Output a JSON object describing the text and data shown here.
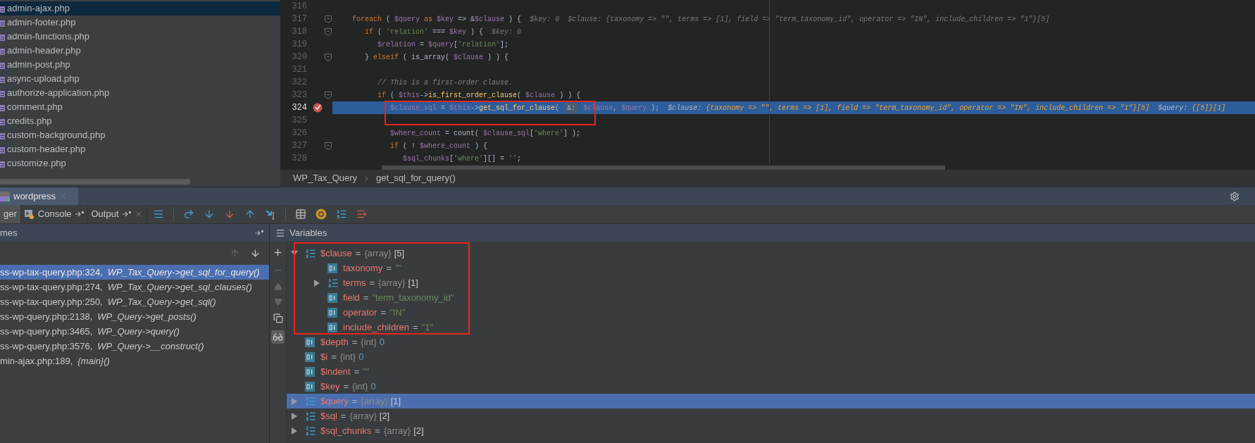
{
  "file_tree": {
    "items": [
      {
        "name": "admin-ajax.php",
        "selected": true
      },
      {
        "name": "admin-footer.php",
        "selected": false
      },
      {
        "name": "admin-functions.php",
        "selected": false
      },
      {
        "name": "admin-header.php",
        "selected": false
      },
      {
        "name": "admin-post.php",
        "selected": false
      },
      {
        "name": "async-upload.php",
        "selected": false
      },
      {
        "name": "authorize-application.php",
        "selected": false
      },
      {
        "name": "comment.php",
        "selected": false
      },
      {
        "name": "credits.php",
        "selected": false
      },
      {
        "name": "custom-background.php",
        "selected": false
      },
      {
        "name": "custom-header.php",
        "selected": false
      },
      {
        "name": "customize.php",
        "selected": false
      }
    ]
  },
  "editor": {
    "lines": [
      {
        "number": "316",
        "current": false,
        "breakpoint": false,
        "fold": false
      },
      {
        "number": "317",
        "current": false,
        "breakpoint": false,
        "fold": true,
        "tokens": [
          {
            "kind": "kw",
            "text": "    foreach"
          },
          {
            "kind": "op",
            "text": " ( "
          },
          {
            "kind": "var",
            "text": "$query"
          },
          {
            "kind": "kw",
            "text": " as "
          },
          {
            "kind": "var",
            "text": "$key"
          },
          {
            "kind": "op",
            "text": " => &"
          },
          {
            "kind": "var",
            "text": "$clause"
          },
          {
            "kind": "op",
            "text": " ) {"
          },
          {
            "kind": "hl",
            "text": "  $key: 0  $clause: "
          },
          {
            "kind": "hv",
            "text": "{taxonomy => \"\", terms => [1], field => \"term_taxonomy_id\", operator => \"IN\", include_children => \"1\"}[5]"
          }
        ]
      },
      {
        "number": "318",
        "current": false,
        "breakpoint": false,
        "fold": true,
        "tokens": [
          {
            "kind": "kw",
            "text": "       if"
          },
          {
            "kind": "op",
            "text": " ( "
          },
          {
            "kind": "str",
            "text": "'relation'"
          },
          {
            "kind": "op",
            "text": " === "
          },
          {
            "kind": "var",
            "text": "$key"
          },
          {
            "kind": "op",
            "text": " ) {"
          },
          {
            "kind": "hl",
            "text": "  $key: 0"
          }
        ]
      },
      {
        "number": "319",
        "current": false,
        "breakpoint": false,
        "fold": false,
        "tokens": [
          {
            "kind": "var",
            "text": "          $relation"
          },
          {
            "kind": "op",
            "text": " = "
          },
          {
            "kind": "var",
            "text": "$query"
          },
          {
            "kind": "op",
            "text": "["
          },
          {
            "kind": "str",
            "text": "'relation'"
          },
          {
            "kind": "op",
            "text": "];"
          }
        ]
      },
      {
        "number": "320",
        "current": false,
        "breakpoint": false,
        "fold": true,
        "tokens": [
          {
            "kind": "op",
            "text": "       } "
          },
          {
            "kind": "kw",
            "text": "elseif"
          },
          {
            "kind": "op",
            "text": " ( is_array( "
          },
          {
            "kind": "var",
            "text": "$clause"
          },
          {
            "kind": "op",
            "text": " ) ) {"
          }
        ]
      },
      {
        "number": "321",
        "current": false,
        "breakpoint": false,
        "fold": false
      },
      {
        "number": "322",
        "current": false,
        "breakpoint": false,
        "fold": false,
        "tokens": [
          {
            "kind": "cm",
            "text": "          // This is a first-order clause."
          }
        ]
      },
      {
        "number": "323",
        "current": false,
        "breakpoint": false,
        "fold": true,
        "tokens": [
          {
            "kind": "kw",
            "text": "          if"
          },
          {
            "kind": "op",
            "text": " ( "
          },
          {
            "kind": "var",
            "text": "$this"
          },
          {
            "kind": "op",
            "text": "->"
          },
          {
            "kind": "fn",
            "text": "is_first_order_clause"
          },
          {
            "kind": "op",
            "text": "( "
          },
          {
            "kind": "var",
            "text": "$clause"
          },
          {
            "kind": "op",
            "text": " ) ) {"
          }
        ]
      },
      {
        "number": "324",
        "current": true,
        "breakpoint": true,
        "fold": false,
        "tokens": [
          {
            "kind": "var",
            "text": "             $clause_sql"
          },
          {
            "kind": "op",
            "text": " = "
          },
          {
            "kind": "var",
            "text": "$this"
          },
          {
            "kind": "op",
            "text": "->"
          },
          {
            "kind": "fn",
            "text": "get_sql_for_clause"
          },
          {
            "kind": "op",
            "text": "( "
          },
          {
            "kind": "badge",
            "text": "&:"
          },
          {
            "kind": "var",
            "text": " $clause"
          },
          {
            "kind": "op",
            "text": ", "
          },
          {
            "kind": "var",
            "text": "$query"
          },
          {
            "kind": "op",
            "text": " );"
          },
          {
            "kind": "hl",
            "text": "  $clause: "
          },
          {
            "kind": "hv",
            "text": "{taxonomy => \"\", terms => [1], field => \"term_taxonomy_id\", operator => \"IN\", include_children => \"1\"}[5]"
          },
          {
            "kind": "hl",
            "text": "  $query: "
          },
          {
            "kind": "hv",
            "text": "{[5]}[1]"
          }
        ]
      },
      {
        "number": "325",
        "current": false,
        "breakpoint": false,
        "fold": false
      },
      {
        "number": "326",
        "current": false,
        "breakpoint": false,
        "fold": false,
        "tokens": [
          {
            "kind": "var",
            "text": "             $where_count"
          },
          {
            "kind": "op",
            "text": " = count( "
          },
          {
            "kind": "var",
            "text": "$clause_sql"
          },
          {
            "kind": "op",
            "text": "["
          },
          {
            "kind": "str",
            "text": "'where'"
          },
          {
            "kind": "op",
            "text": "] );"
          }
        ]
      },
      {
        "number": "327",
        "current": false,
        "breakpoint": false,
        "fold": true,
        "tokens": [
          {
            "kind": "kw",
            "text": "             if"
          },
          {
            "kind": "op",
            "text": " ( ! "
          },
          {
            "kind": "var",
            "text": "$where_count"
          },
          {
            "kind": "op",
            "text": " ) {"
          }
        ]
      },
      {
        "number": "328",
        "current": false,
        "breakpoint": false,
        "fold": false,
        "tokens": [
          {
            "kind": "var",
            "text": "                $sql_chunks"
          },
          {
            "kind": "op",
            "text": "["
          },
          {
            "kind": "str",
            "text": "'where'"
          },
          {
            "kind": "op",
            "text": "][] = "
          },
          {
            "kind": "str",
            "text": "''"
          },
          {
            "kind": "op",
            "text": ";"
          }
        ]
      }
    ],
    "breadcrumb": [
      "WP_Tax_Query",
      "get_sql_for_query()"
    ]
  },
  "debug_tabs": [
    {
      "label": "wordpress",
      "selected": true
    }
  ],
  "debug_toolbar": {
    "tabs": [
      {
        "label": "ger",
        "selected": true,
        "pinnable": false,
        "closable": false
      },
      {
        "label": "Console",
        "selected": false,
        "pinnable": true,
        "closable": false
      },
      {
        "label": "Output",
        "selected": false,
        "pinnable": true,
        "closable": true
      }
    ]
  },
  "frames": {
    "title": "mes",
    "items": [
      {
        "location": "ss-wp-tax-query.php:324,",
        "method": "WP_Tax_Query->get_sql_for_query()",
        "selected": true
      },
      {
        "location": "ss-wp-tax-query.php:274,",
        "method": "WP_Tax_Query->get_sql_clauses()",
        "selected": false
      },
      {
        "location": "ss-wp-tax-query.php:250,",
        "method": "WP_Tax_Query->get_sql()",
        "selected": false
      },
      {
        "location": "ss-wp-query.php:2138,",
        "method": "WP_Query->get_posts()",
        "selected": false
      },
      {
        "location": "ss-wp-query.php:3465,",
        "method": "WP_Query->query()",
        "selected": false
      },
      {
        "location": "ss-wp-query.php:3576,",
        "method": "WP_Query->__construct()",
        "selected": false
      },
      {
        "location": "min-ajax.php:189,",
        "method": "{main}()",
        "selected": false
      }
    ]
  },
  "variables": {
    "title": "Variables",
    "items": [
      {
        "kind": "array",
        "name": "$clause",
        "sep": "=",
        "type": "{array}",
        "value": {
          "kind": "count",
          "text": "[5]"
        },
        "expanded": true,
        "selected": false,
        "children": [
          {
            "kind": "scalar",
            "name": "taxonomy",
            "sep": "=",
            "value": {
              "kind": "string",
              "text": "\"\""
            },
            "selected": false
          },
          {
            "kind": "array",
            "name": "terms",
            "sep": "=",
            "type": "{array}",
            "value": {
              "kind": "count",
              "text": "[1]"
            },
            "expanded": false,
            "selected": false
          },
          {
            "kind": "scalar",
            "name": "field",
            "sep": "=",
            "value": {
              "kind": "string",
              "text": "\"term_taxonomy_id\""
            },
            "selected": false
          },
          {
            "kind": "scalar",
            "name": "operator",
            "sep": "=",
            "value": {
              "kind": "string",
              "text": "\"IN\""
            },
            "selected": false
          },
          {
            "kind": "scalar",
            "name": "include_children",
            "sep": "=",
            "value": {
              "kind": "string",
              "text": "\"1\""
            },
            "selected": false
          }
        ]
      },
      {
        "kind": "scalar",
        "name": "$depth",
        "sep": "=",
        "type": "{int}",
        "value": {
          "kind": "number",
          "text": "0"
        },
        "selected": false
      },
      {
        "kind": "scalar",
        "name": "$i",
        "sep": "=",
        "type": "{int}",
        "value": {
          "kind": "number",
          "text": "0"
        },
        "selected": false
      },
      {
        "kind": "scalar",
        "name": "$indent",
        "sep": "=",
        "value": {
          "kind": "string",
          "text": "\"\""
        },
        "selected": false
      },
      {
        "kind": "scalar",
        "name": "$key",
        "sep": "=",
        "type": "{int}",
        "value": {
          "kind": "number",
          "text": "0"
        },
        "selected": false
      },
      {
        "kind": "array",
        "name": "$query",
        "sep": "=",
        "type": "{array}",
        "value": {
          "kind": "count",
          "text": "[1]"
        },
        "expanded": false,
        "selected": true
      },
      {
        "kind": "array",
        "name": "$sql",
        "sep": "=",
        "type": "{array}",
        "value": {
          "kind": "count",
          "text": "[2]"
        },
        "expanded": false,
        "selected": false
      },
      {
        "kind": "array",
        "name": "$sql_chunks",
        "sep": "=",
        "type": "{array}",
        "value": {
          "kind": "count",
          "text": "[2]"
        },
        "expanded": false,
        "selected": false
      }
    ]
  }
}
